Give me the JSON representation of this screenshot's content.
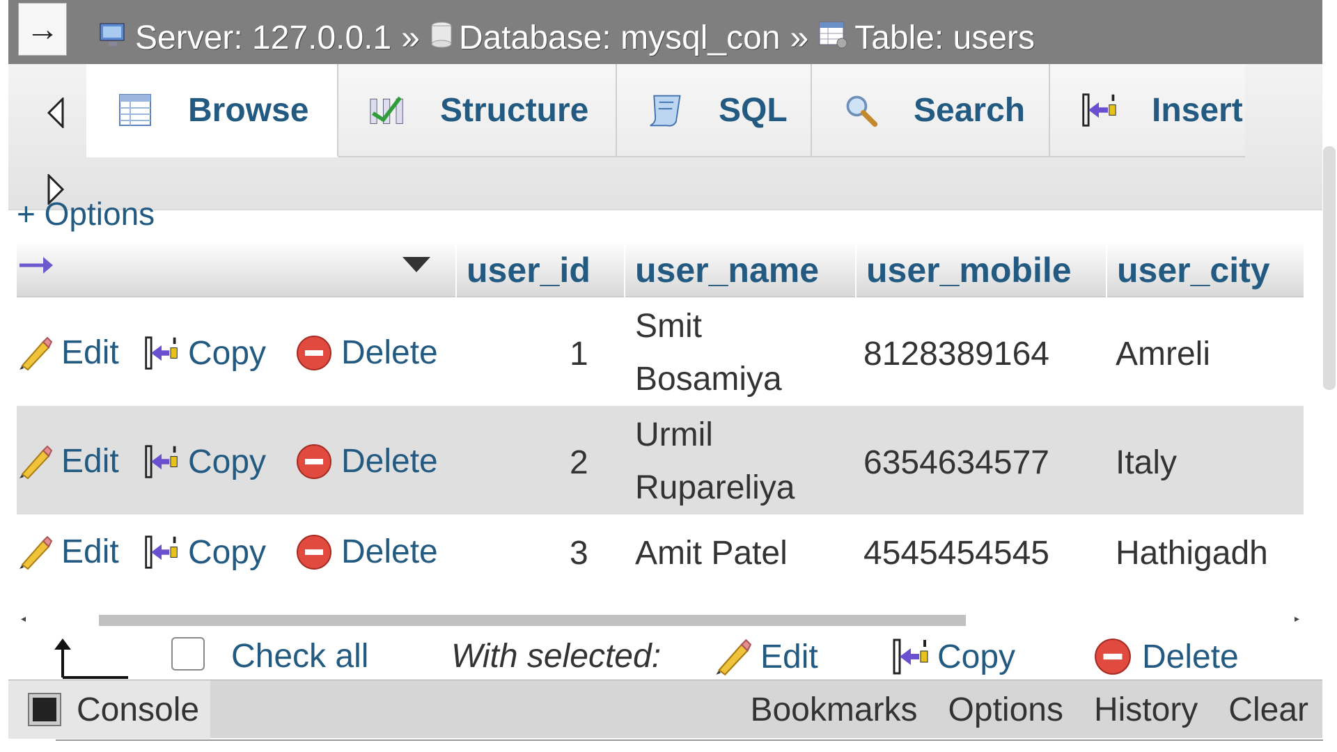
{
  "breadcrumb": {
    "server": "Server: 127.0.0.1",
    "database": "Database: mysql_con",
    "table": "Table: users",
    "separator": "»",
    "back_arrow": "→"
  },
  "tabs": [
    {
      "label": "Browse",
      "icon": "browse-icon",
      "active": true
    },
    {
      "label": "Structure",
      "icon": "structure-icon",
      "active": false
    },
    {
      "label": "SQL",
      "icon": "sql-icon",
      "active": false
    },
    {
      "label": "Search",
      "icon": "search-icon",
      "active": false
    },
    {
      "label": "Insert",
      "icon": "insert-icon",
      "active": false
    }
  ],
  "options_label": "+ Options",
  "table": {
    "columns": [
      "user_id",
      "user_name",
      "user_mobile",
      "user_city"
    ],
    "row_actions": {
      "edit": "Edit",
      "copy": "Copy",
      "delete": "Delete"
    },
    "rows": [
      {
        "user_id": "1",
        "user_name_1": "Smit",
        "user_name_2": "Bosamiya",
        "user_mobile": "8128389164",
        "user_city": "Amreli"
      },
      {
        "user_id": "2",
        "user_name_1": "Urmil",
        "user_name_2": "Rupareliya",
        "user_mobile": "6354634577",
        "user_city": "Italy"
      },
      {
        "user_id": "3",
        "user_name_1": "Amit Patel",
        "user_name_2": "",
        "user_mobile": "4545454545",
        "user_city": "Hathigadh"
      }
    ]
  },
  "bulk": {
    "check_all": "Check all",
    "with_selected": "With selected:",
    "edit": "Edit",
    "copy": "Copy",
    "delete": "Delete"
  },
  "console": {
    "label": "Console",
    "links": [
      "Bookmarks",
      "Options",
      "History",
      "Clear"
    ]
  },
  "colors": {
    "link": "#235a81",
    "topbar": "#7f7f7f",
    "row_alt": "#dfdfdf"
  }
}
